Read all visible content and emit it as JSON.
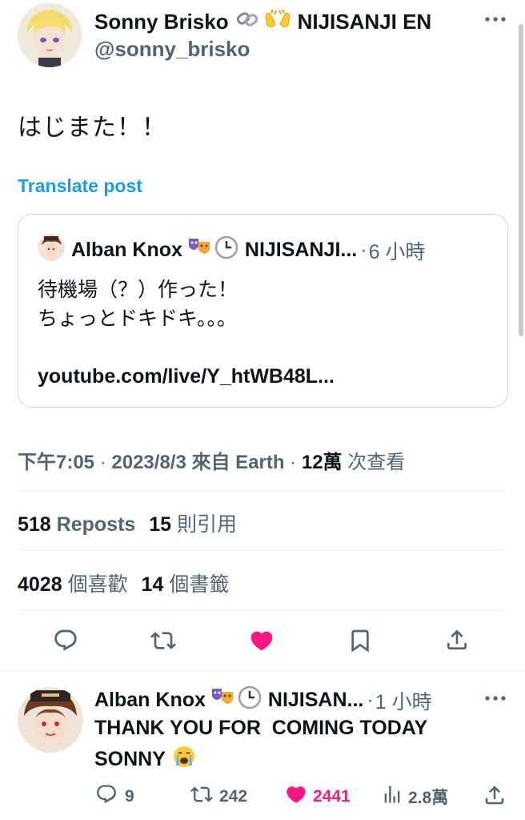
{
  "main_tweet": {
    "author_name": "Sonny Brisko",
    "author_suffix": "NIJISANJI EN",
    "handle": "@sonny_brisko",
    "text": "はじまた！！",
    "translate_label": "Translate post",
    "quote": {
      "author_name": "Alban Knox",
      "author_suffix": "NIJISANJI...",
      "time_sep": "·",
      "time": "6 小時",
      "text_line1": "待機場（？）作った！",
      "text_line2": "ちょっとドキドキ。。。",
      "link": "youtube.com/live/Y_htWB48L..."
    },
    "meta": {
      "time": "下午7:05",
      "sep1": "·",
      "date": "2023/8/3",
      "source": "來自 Earth",
      "sep2": "·",
      "views_count": "12萬",
      "views_label": "次查看"
    },
    "stats": {
      "reposts_count": "518",
      "reposts_label": "Reposts",
      "quotes_count": "15",
      "quotes_label": "則引用",
      "likes_count": "4028",
      "likes_label": "個喜歡",
      "bookmarks_count": "14",
      "bookmarks_label": "個書籤"
    },
    "actions": [
      "reply-icon",
      "repost-icon",
      "heart-filled-icon",
      "bookmark-icon",
      "share-icon"
    ]
  },
  "reply_tweet": {
    "author_name": "Alban Knox",
    "author_suffix": "NIJISAN...",
    "time_sep": "·",
    "time": "1 小時",
    "text_line1": "THANK YOU FOR  COMING TODAY",
    "text_line2": "SONNY",
    "actions": {
      "replies": "9",
      "reposts": "242",
      "likes": "2441",
      "views": "2.8萬"
    }
  },
  "colors": {
    "link_blue": "#1d9bf0",
    "like_pink": "#f91880",
    "text_gray": "#536471",
    "divider": "#eff3f4"
  }
}
